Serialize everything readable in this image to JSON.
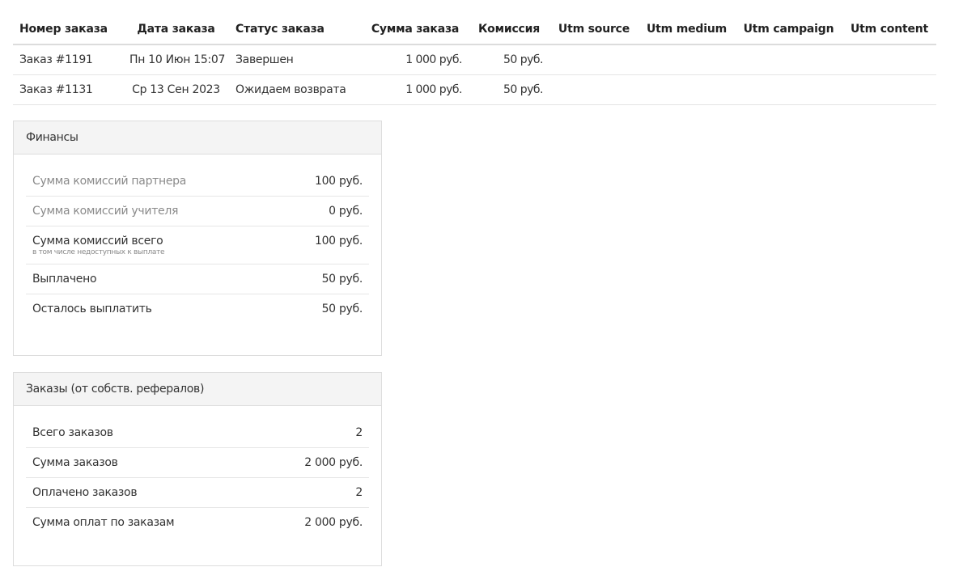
{
  "orders_table": {
    "headers": [
      "Номер заказа",
      "Дата заказа",
      "Статус заказа",
      "Сумма заказа",
      "Комиссия",
      "Utm source",
      "Utm medium",
      "Utm campaign",
      "Utm content"
    ],
    "rows": [
      {
        "number": "Заказ #1191",
        "date": "Пн 10 Июн 15:07",
        "status": "Завершен",
        "sum": "1 000 руб.",
        "commission": "50 руб.",
        "utm_source": "",
        "utm_medium": "",
        "utm_campaign": "",
        "utm_content": ""
      },
      {
        "number": "Заказ #1131",
        "date": "Ср 13 Сен 2023",
        "status": "Ожидаем возврата",
        "sum": "1 000 руб.",
        "commission": "50 руб.",
        "utm_source": "",
        "utm_medium": "",
        "utm_campaign": "",
        "utm_content": ""
      }
    ]
  },
  "finance": {
    "title": "Финансы",
    "rows": [
      {
        "label": "Сумма комиссий партнера",
        "note": "",
        "value": "100 руб."
      },
      {
        "label": "Сумма комиссий учителя",
        "note": "",
        "value": "0 руб."
      },
      {
        "label": "Сумма комиссий всего",
        "note": "в том числе недоступных к выплате",
        "value": "100 руб."
      },
      {
        "label": "Выплачено",
        "note": "",
        "value": "50 руб."
      },
      {
        "label": "Осталось выплатить",
        "note": "",
        "value": "50 руб."
      }
    ]
  },
  "referral_orders": {
    "title": "Заказы (от собств. рефералов)",
    "rows": [
      {
        "label": "Всего заказов",
        "value": "2"
      },
      {
        "label": "Сумма заказов",
        "value": "2 000 руб."
      },
      {
        "label": "Оплачено заказов",
        "value": "2"
      },
      {
        "label": "Сумма оплат по заказам",
        "value": "2 000 руб."
      }
    ]
  }
}
